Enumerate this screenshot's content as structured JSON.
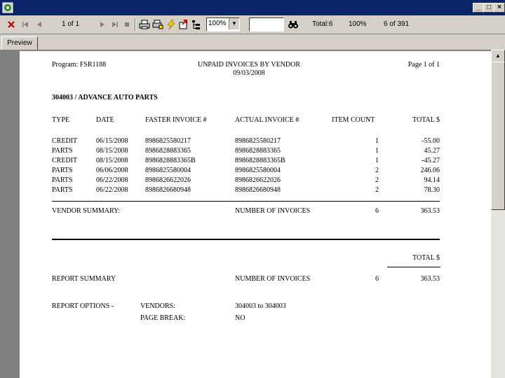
{
  "window": {
    "title": ""
  },
  "toolbar": {
    "page_indicator": "1 of 1",
    "zoom": "100%",
    "search_value": "",
    "total_label": "Total:6",
    "percent_label": "100%",
    "count_label": "6 of 391"
  },
  "tabs": {
    "preview": "Preview"
  },
  "report": {
    "program": "Program: FSR1188",
    "title": "UNPAID INVOICES BY VENDOR",
    "date": "09/03/2008",
    "page": "Page 1 of 1",
    "vendor_heading": "304003 / ADVANCE AUTO PARTS",
    "columns": [
      "TYPE",
      "DATE",
      "FASTER INVOICE #",
      "ACTUAL INVOICE #",
      "ITEM COUNT",
      "TOTAL $"
    ],
    "rows": [
      [
        "CREDIT",
        "06/15/2008",
        "8986825580217",
        "8986825580217",
        "1",
        "-55.00"
      ],
      [
        "PARTS",
        "08/15/2008",
        "8986828883365",
        "8986828883365",
        "1",
        "45.27"
      ],
      [
        "CREDIT",
        "08/15/2008",
        "8986828883365B",
        "8986828883365B",
        "1",
        "-45.27"
      ],
      [
        "PARTS",
        "06/06/2008",
        "8986825580004",
        "8986825580004",
        "2",
        "246.06"
      ],
      [
        "PARTS",
        "06/22/2008",
        "8986826622026",
        "8986826622026",
        "2",
        "94.14"
      ],
      [
        "PARTS",
        "06/22/2008",
        "8986826680948",
        "8986826680948",
        "2",
        "78.30"
      ]
    ],
    "vendor_summary_label": "VENDOR SUMMARY:",
    "number_of_invoices_label": "NUMBER OF INVOICES",
    "vendor_invoice_count": "6",
    "vendor_total": "363.53",
    "total_header": "TOTAL $",
    "report_summary_label": "REPORT SUMMARY",
    "report_invoice_count": "6",
    "report_total": "363.53",
    "report_options_label": "REPORT OPTIONS -",
    "vendors_label": "VENDORS:",
    "vendors_value": "304003 to 304003",
    "page_break_label": "PAGE BREAK:",
    "page_break_value": "NO"
  },
  "colors": {
    "titlebar": "#0a246a",
    "chrome": "#d4d0c8",
    "page_bg": "#808080",
    "close_x": "#c00000"
  }
}
